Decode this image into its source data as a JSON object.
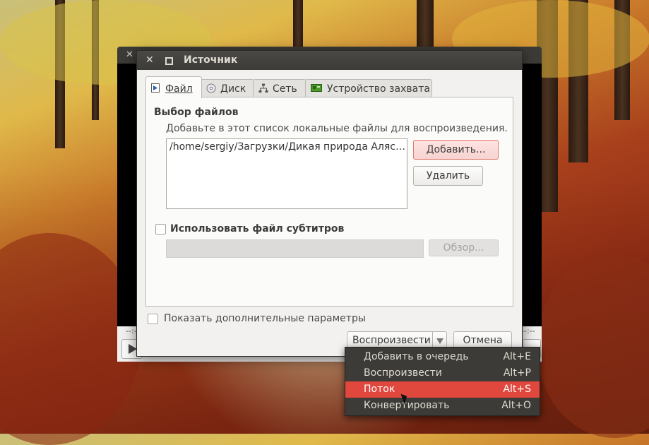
{
  "window": {
    "title": "Источник"
  },
  "tabs": [
    {
      "label": "Файл",
      "icon": "file-play-icon"
    },
    {
      "label": "Диск",
      "icon": "disc-icon"
    },
    {
      "label": "Сеть",
      "icon": "network-icon"
    },
    {
      "label": "Устройство захвата",
      "icon": "capture-card-icon"
    }
  ],
  "file_section": {
    "title": "Выбор файлов",
    "hint": "Добавьте в этот список локальные файлы для воспроизведения.",
    "files": [
      "/home/sergiy/Загрузки/Дикая природа Аляс…"
    ],
    "add_button": "Добавить...",
    "remove_button": "Удалить"
  },
  "subtitle_section": {
    "checkbox_label": "Использовать файл субтитров",
    "checked": false,
    "path_value": "",
    "browse_button": "Обзор..."
  },
  "footer": {
    "show_more_label": "Показать дополнительные параметры",
    "show_more_checked": false,
    "play_button": "Воспроизвести",
    "cancel_button": "Отмена"
  },
  "play_menu": {
    "items": [
      {
        "label": "Добавить в очередь",
        "shortcut": "Alt+E"
      },
      {
        "label": "Воспроизвести",
        "shortcut": "Alt+P"
      },
      {
        "label": "Поток",
        "shortcut": "Alt+S",
        "highlighted": true
      },
      {
        "label": "Конвертировать",
        "shortcut": "Alt+O"
      }
    ]
  },
  "background_player": {
    "time_left": "--:--",
    "time_right": "--:--"
  },
  "colors": {
    "menu_highlight": "#e0473d",
    "titlebar": "#3c3b37",
    "add_button_highlight": "#f7d3d0"
  }
}
